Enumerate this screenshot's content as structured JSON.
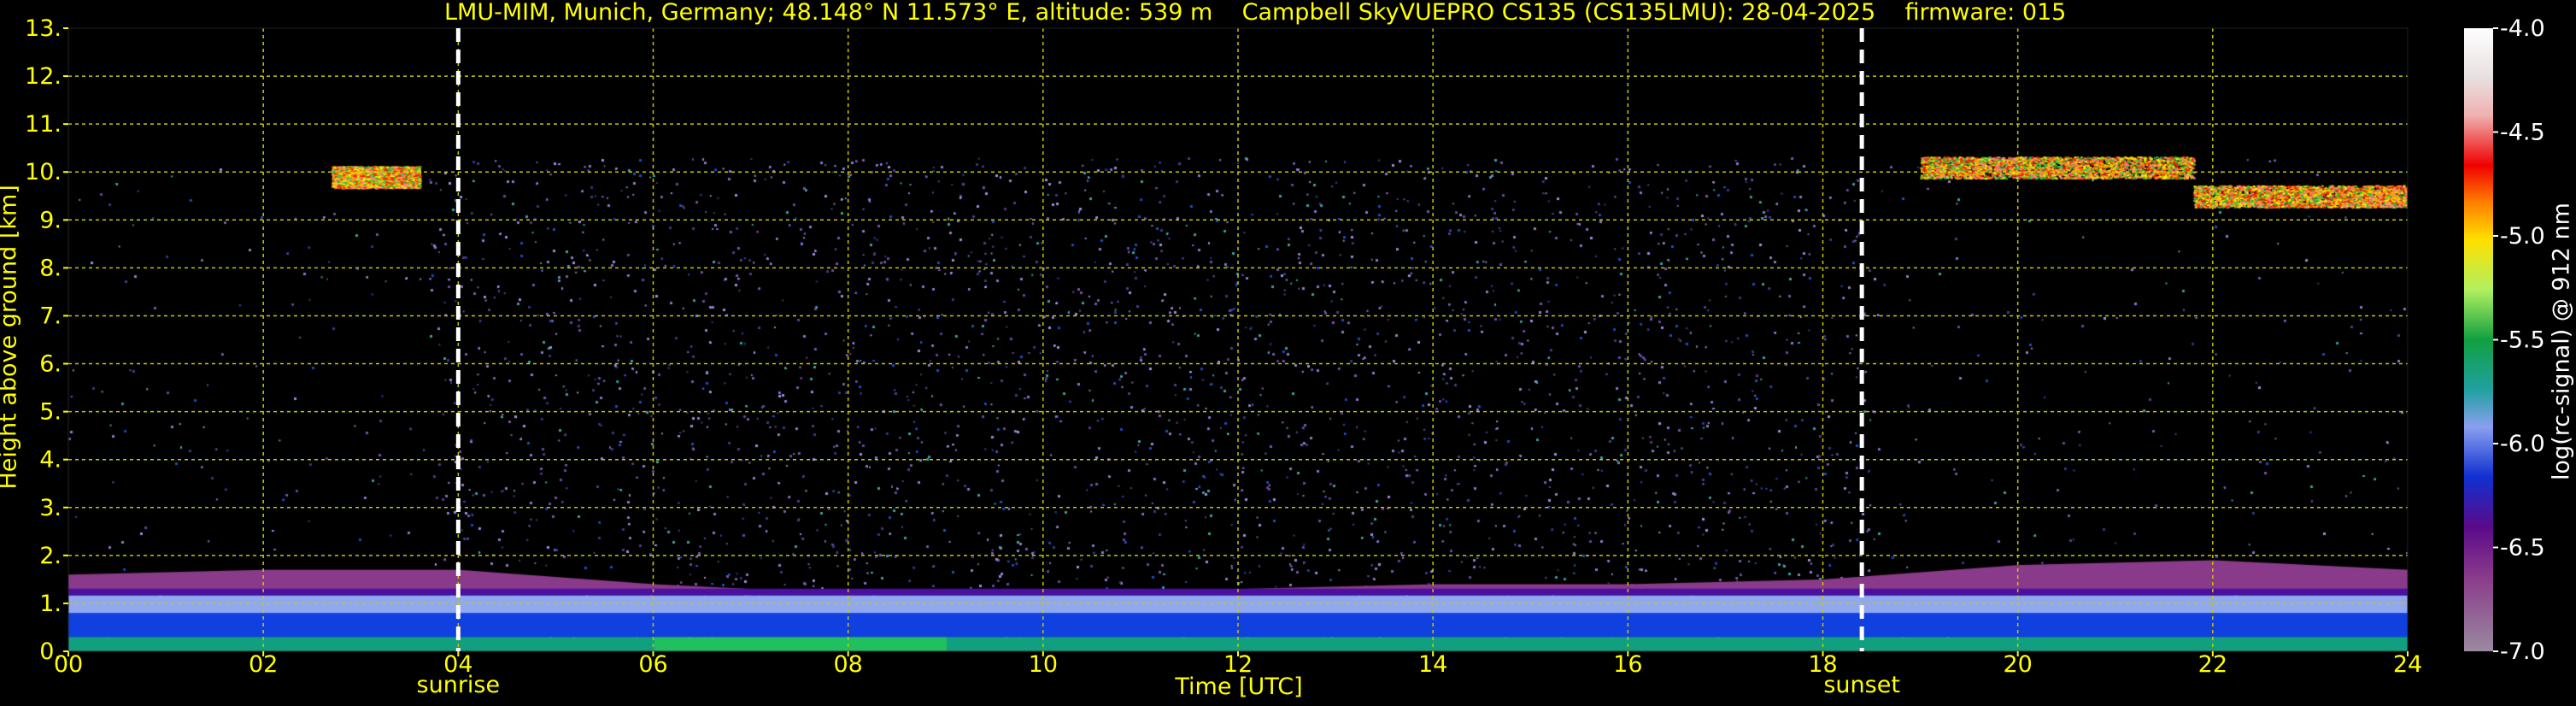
{
  "title": "LMU-MIM, Munich, Germany; 48.148° N 11.573° E, altitude: 539 m    Campbell SkyVUEPRO CS135 (CS135LMU): 28-04-2025    firmware: 015",
  "colors": {
    "text": "#ffff00",
    "grid": "#c8c800",
    "marker": "#ffffff",
    "background": "#000000"
  },
  "chart_data": {
    "type": "heatmap",
    "xlabel": "Time [UTC]",
    "ylabel": "Height above ground [km]",
    "colorbar_label": "log(rc-signal) @ 912 nm",
    "xlim": [
      0,
      24
    ],
    "ylim": [
      0,
      13
    ],
    "x_ticks": [
      "00",
      "02",
      "04",
      "06",
      "08",
      "10",
      "12",
      "14",
      "16",
      "18",
      "20",
      "22",
      "24"
    ],
    "y_ticks": [
      "0.",
      "1.",
      "2.",
      "3.",
      "4.",
      "5.",
      "6.",
      "7.",
      "8.",
      "9.",
      "10.",
      "11.",
      "12.",
      "13."
    ],
    "colorbar_range": [
      -7.0,
      -4.0
    ],
    "colorbar_ticks": [
      "-7.0",
      "-6.5",
      "-6.0",
      "-5.5",
      "-5.0",
      "-4.5",
      "-4.0"
    ],
    "grid": true,
    "events": [
      {
        "label": "sunrise",
        "time": 4.0
      },
      {
        "label": "sunset",
        "time": 18.4
      }
    ],
    "features": {
      "data_top_km": 10.3,
      "boundary_layer_top_km": [
        [
          0,
          1.6
        ],
        [
          2,
          1.7
        ],
        [
          4,
          1.7
        ],
        [
          6,
          1.4
        ],
        [
          8,
          1.2
        ],
        [
          10,
          1.2
        ],
        [
          12,
          1.3
        ],
        [
          14,
          1.4
        ],
        [
          16,
          1.4
        ],
        [
          18,
          1.5
        ],
        [
          20,
          1.8
        ],
        [
          22,
          1.9
        ],
        [
          24,
          1.7
        ]
      ],
      "cirrus": [
        {
          "start": 19.0,
          "end": 21.8,
          "height_km": 10.1
        },
        {
          "start": 21.8,
          "end": 24.0,
          "height_km": 9.5
        },
        {
          "start": 2.7,
          "end": 3.6,
          "height_km": 9.9
        }
      ]
    }
  }
}
